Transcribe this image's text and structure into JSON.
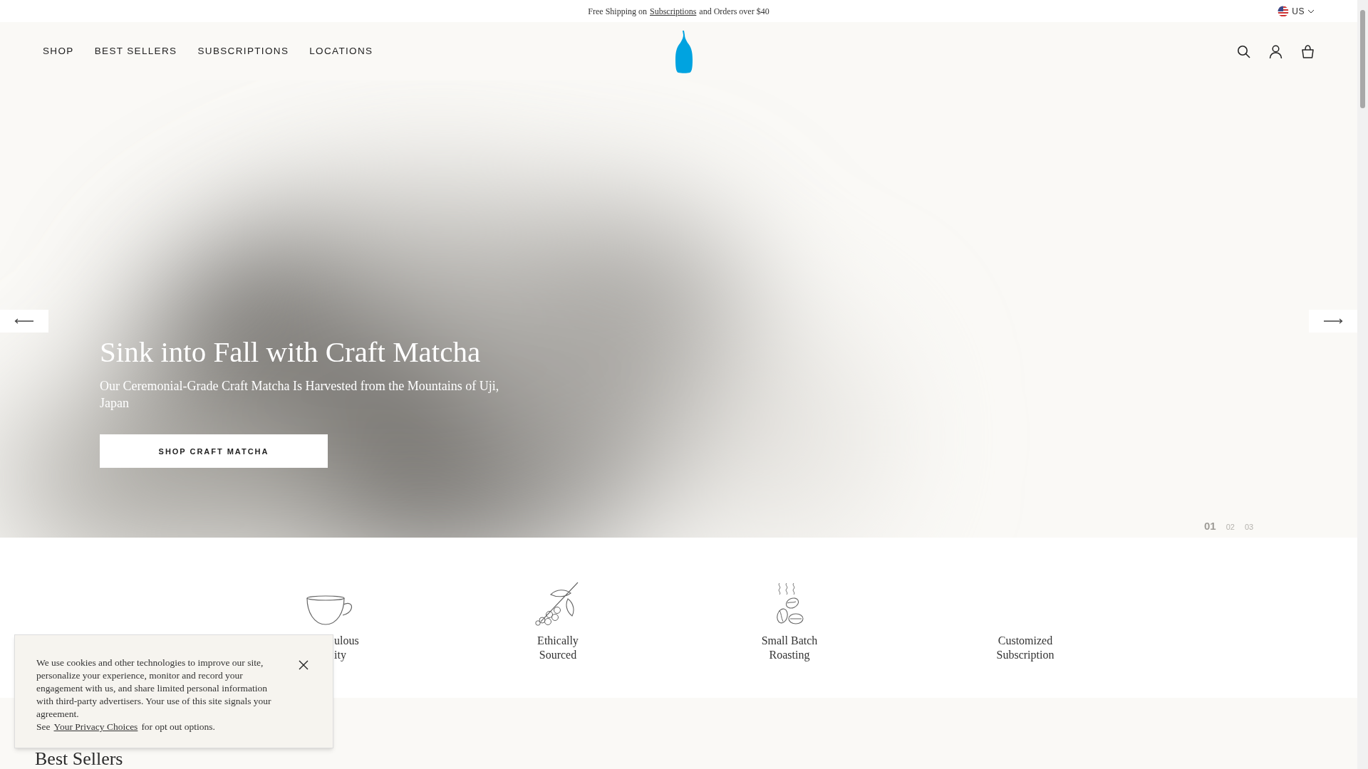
{
  "promo_bar": {
    "text_before": "Free Shipping on",
    "link": "Subscriptions",
    "text_after": "and Orders over $40",
    "region": "US"
  },
  "nav": {
    "items": [
      "SHOP",
      "BEST SELLERS",
      "SUBSCRIPTIONS",
      "LOCATIONS"
    ]
  },
  "hero": {
    "title": "Sink into Fall with Craft Matcha",
    "subtitle": "Our Ceremonial-Grade Craft Matcha Is Harvested from the Mountains of Uji, Japan",
    "button": "SHOP CRAFT MATCHA",
    "slides": [
      {
        "label": "01",
        "selected": true
      },
      {
        "label": "02",
        "selected": false
      },
      {
        "label": "03",
        "selected": false
      }
    ]
  },
  "features": [
    {
      "kind": "cup",
      "lines": [
        "ulous",
        "ity"
      ]
    },
    {
      "kind": "branch",
      "lines": [
        "Ethically",
        "Sourced"
      ]
    },
    {
      "kind": "beans",
      "lines": [
        "Small Batch",
        "Roasting"
      ]
    },
    {
      "kind": "none",
      "lines": [
        "Customized",
        "Subscription"
      ]
    }
  ],
  "best_sellers": {
    "title": "Best Sellers"
  },
  "cookie_banner": {
    "text": "We use cookies and other technologies to improve our site, personalize your experience, monitor and record your engagement with us, and share limited personal information with third-party advertisers. Your use of this site signals your agreement.",
    "see": "See",
    "link": "Your Privacy Choices",
    "after": "for opt out options."
  }
}
